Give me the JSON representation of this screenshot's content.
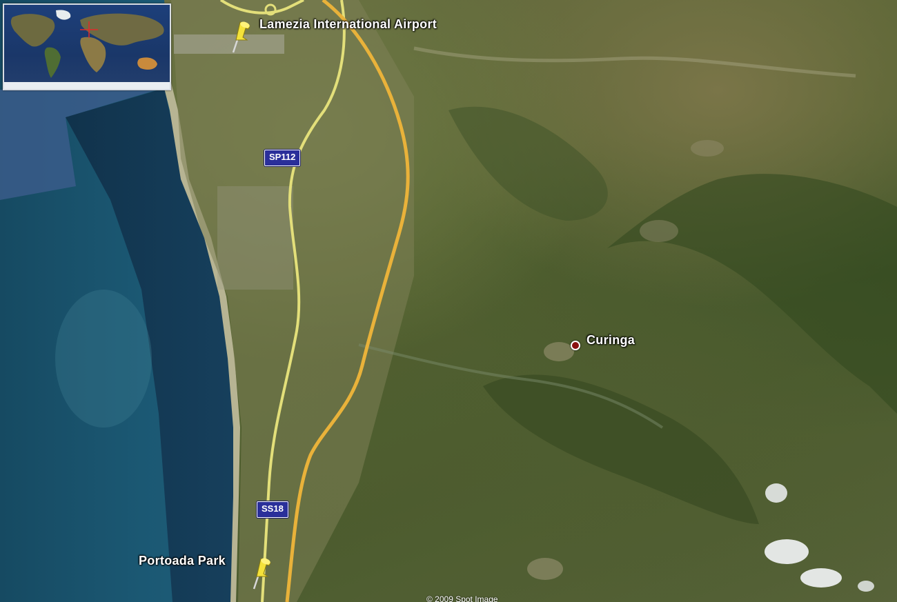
{
  "map": {
    "type": "satellite",
    "accent_colors": {
      "highway": "#e9b23a",
      "secondary_road": "#e3df7a",
      "sea": "#1d4f6b",
      "shield": "#2a2f9a"
    }
  },
  "places": {
    "airport": "Lamezia International Airport",
    "curinga": "Curinga",
    "portoada": "Portoada Park"
  },
  "roads": {
    "sp112": "SP112",
    "ss18": "SS18"
  },
  "icons": {
    "placemark": "yellow-pushpin-icon",
    "town": "red-dot-icon"
  },
  "copyright": "© 2009 Spot Image"
}
